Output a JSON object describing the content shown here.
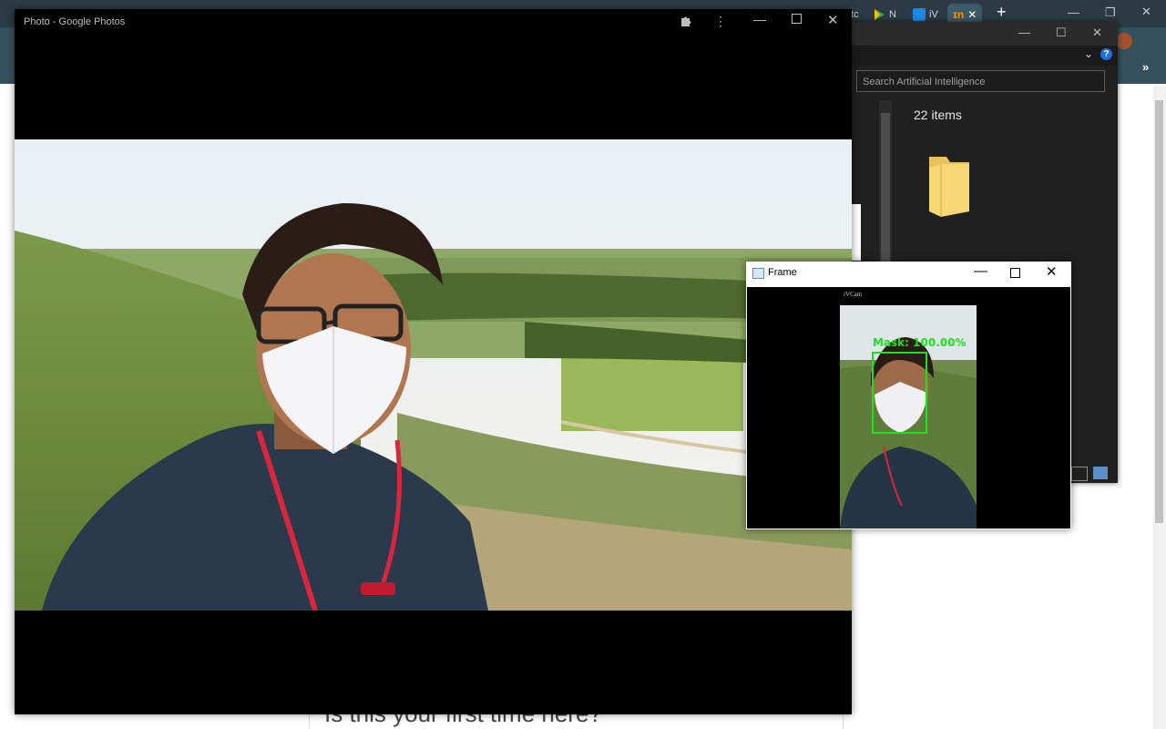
{
  "photos_window": {
    "title": "Photo - Google Photos"
  },
  "explorer_window": {
    "search_placeholder": "Search Artificial Intelligence",
    "item_count": "22 items",
    "help_label": "?"
  },
  "frame_window": {
    "title": "Frame",
    "watermark": "iVCam",
    "detection_label": "Mask:  100.00%",
    "box_color": "#19e619"
  },
  "browser_background": {
    "tab_labels": [
      "tc",
      "N",
      "iV"
    ],
    "partial_text": "Is this your first time here?"
  },
  "icons": {
    "extension": "puzzle-icon",
    "more": "more-vert-icon",
    "folder": "folder-icon"
  }
}
